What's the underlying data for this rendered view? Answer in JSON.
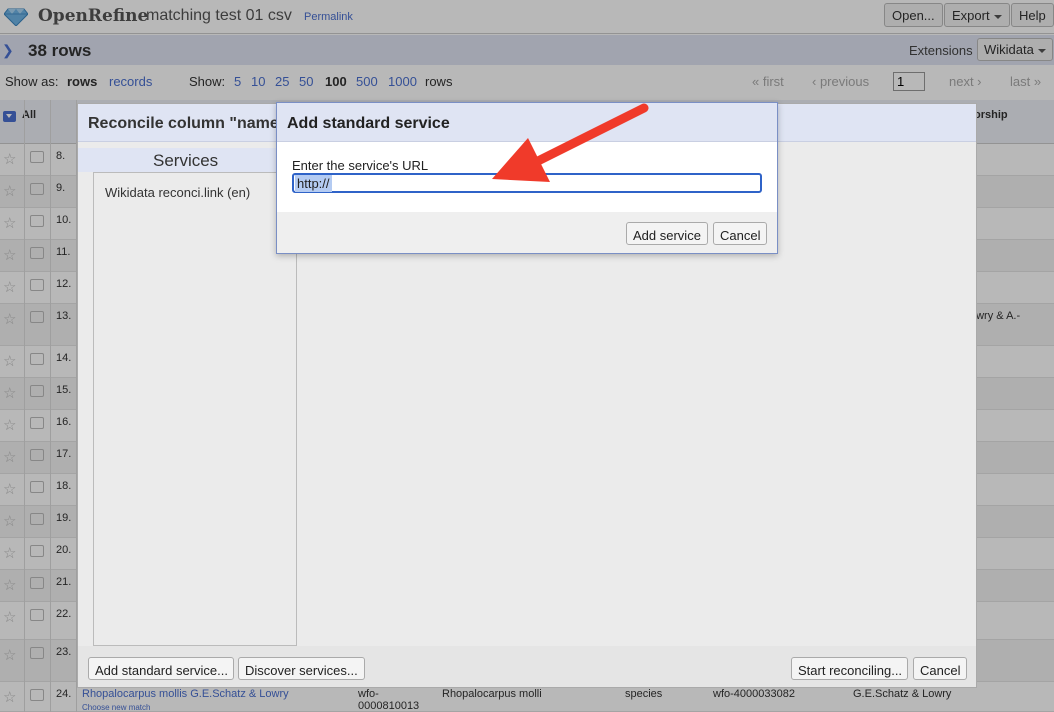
{
  "header": {
    "brand": "OpenRefine",
    "project_name": "matching test 01 csv",
    "permalink": "Permalink",
    "open_label": "Open...",
    "export_label": "Export",
    "help_label": "Help"
  },
  "rowbar": {
    "row_count": "38 rows",
    "extensions_label": "Extensions",
    "wikidata_label": "Wikidata"
  },
  "showbar": {
    "show_as_label": "Show as:",
    "rows_label": "rows",
    "records_label": "records",
    "show_label": "Show:",
    "page_sizes": [
      "5",
      "10",
      "25",
      "50",
      "100",
      "500",
      "1000"
    ],
    "selected_page_size": "100",
    "rows_suffix": "rows",
    "first_label": "« first",
    "previous_label": "‹ previous",
    "page_value": "1",
    "next_label": "next ›",
    "last_label": "last »"
  },
  "grid": {
    "all_label": "All",
    "partial_column_header": "orship",
    "rows": [
      {
        "num": "8.",
        "extra": ""
      },
      {
        "num": "9.",
        "extra": ""
      },
      {
        "num": "10.",
        "extra": ""
      },
      {
        "num": "11.",
        "extra": ""
      },
      {
        "num": "12.",
        "extra": ""
      },
      {
        "num": "13.",
        "extra": "owry & A.-"
      },
      {
        "num": "14.",
        "extra": ""
      },
      {
        "num": "15.",
        "extra": ""
      },
      {
        "num": "16.",
        "extra": ""
      },
      {
        "num": "17.",
        "extra": ""
      },
      {
        "num": "18.",
        "extra": ""
      },
      {
        "num": "19.",
        "extra": ""
      },
      {
        "num": "20.",
        "extra": ""
      },
      {
        "num": "21.",
        "extra": ""
      },
      {
        "num": "22.",
        "extra": ""
      },
      {
        "num": "23.",
        "extra": ""
      }
    ],
    "row24": {
      "num": "24.",
      "name": "Rhopalocarpus mollis G.E.Schatz & Lowry",
      "choose": "Choose new match",
      "id_line1": "wfo-",
      "id_line2": "0000810013",
      "species_name": "Rhopalocarpus molli",
      "rank": "species",
      "wfo_id": "wfo-4000033082",
      "authorship": "G.E.Schatz & Lowry"
    }
  },
  "reconcile_dialog": {
    "title": "Reconcile column \"name",
    "services_heading": "Services",
    "services": [
      "Wikidata reconci.link (en)"
    ],
    "add_standard_label": "Add standard service...",
    "discover_label": "Discover services...",
    "start_label": "Start reconciling...",
    "cancel_label": "Cancel"
  },
  "add_service_dialog": {
    "title": "Add standard service",
    "url_label": "Enter the service's URL",
    "url_value": "http://",
    "add_label": "Add service",
    "cancel_label": "Cancel"
  },
  "colors": {
    "accent": "#4a6fd0",
    "title_bar": "#dfe4f3",
    "input_focus": "#2f63c8",
    "arrow": "#f03a2a"
  }
}
